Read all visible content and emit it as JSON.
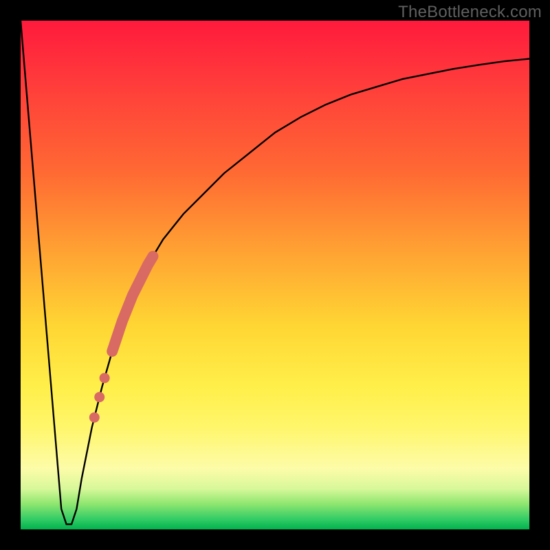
{
  "watermark": "TheBottleneck.com",
  "chart_data": {
    "type": "line",
    "title": "",
    "xlabel": "",
    "ylabel": "",
    "xlim": [
      0,
      100
    ],
    "ylim": [
      0,
      100
    ],
    "grid": false,
    "legend": false,
    "background": {
      "kind": "vertical-gradient",
      "stops": [
        {
          "pos": 0.0,
          "color": "#ff1a3c"
        },
        {
          "pos": 0.12,
          "color": "#ff3b3b"
        },
        {
          "pos": 0.3,
          "color": "#ff6a33"
        },
        {
          "pos": 0.45,
          "color": "#ffa133"
        },
        {
          "pos": 0.6,
          "color": "#ffd633"
        },
        {
          "pos": 0.72,
          "color": "#ffef4a"
        },
        {
          "pos": 0.8,
          "color": "#fff66b"
        },
        {
          "pos": 0.88,
          "color": "#fdfca8"
        },
        {
          "pos": 0.92,
          "color": "#d8f89a"
        },
        {
          "pos": 0.95,
          "color": "#8ee66f"
        },
        {
          "pos": 0.98,
          "color": "#33cc66"
        },
        {
          "pos": 1.0,
          "color": "#00b34d"
        }
      ]
    },
    "series": [
      {
        "name": "bottleneck-curve",
        "color": "#000000",
        "x": [
          0,
          1,
          2,
          3,
          4,
          5,
          6,
          7,
          8,
          9,
          10,
          11,
          12,
          14,
          16,
          18,
          20,
          22,
          25,
          28,
          32,
          36,
          40,
          45,
          50,
          55,
          60,
          65,
          70,
          75,
          80,
          85,
          90,
          95,
          100
        ],
        "y": [
          100,
          88,
          76,
          64,
          52,
          40,
          28,
          16,
          4,
          1,
          1,
          4,
          10,
          20,
          28,
          35,
          41,
          46,
          52,
          57,
          62,
          66,
          70,
          74,
          78,
          81,
          83.5,
          85.5,
          87,
          88.5,
          89.5,
          90.5,
          91.3,
          92,
          92.5
        ]
      }
    ],
    "highlight_segment": {
      "name": "thick-highlight",
      "color": "#d86a63",
      "x_start": 18,
      "x_end": 26,
      "approx_y_start": 35,
      "approx_y_end": 54
    },
    "highlight_points": {
      "name": "dots",
      "color": "#d86a63",
      "points": [
        {
          "x": 16.5,
          "y": 30
        },
        {
          "x": 15.5,
          "y": 26
        },
        {
          "x": 14.5,
          "y": 22
        }
      ]
    }
  }
}
